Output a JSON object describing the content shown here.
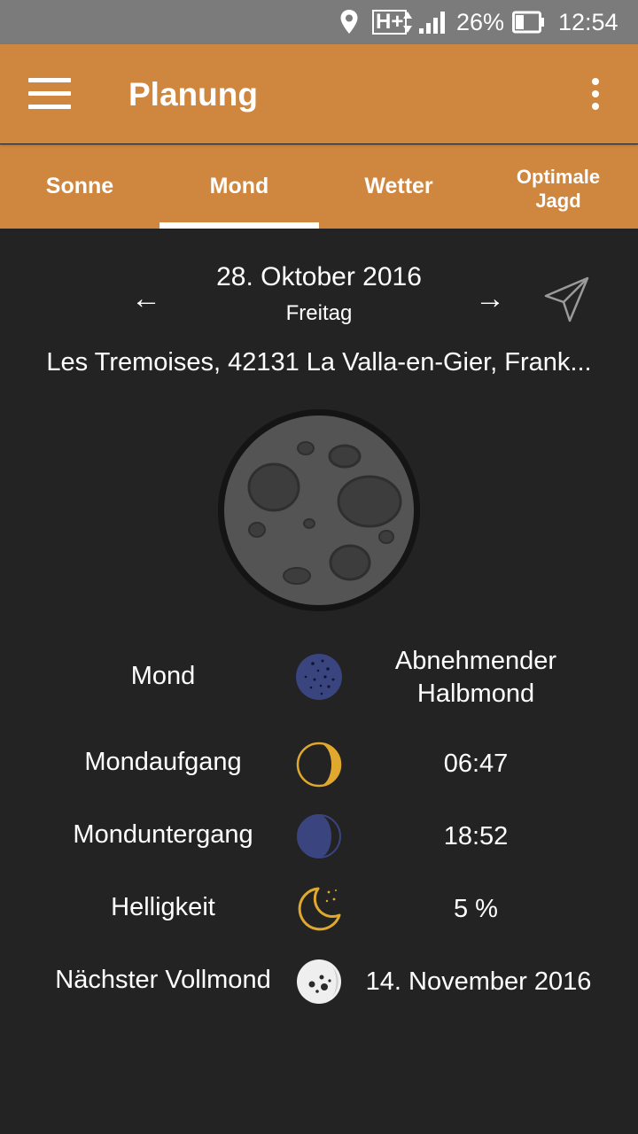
{
  "status_bar": {
    "network": "H+",
    "battery": "26%",
    "time": "12:54",
    "icons": [
      "location-pin-icon",
      "network-arrows-icon",
      "signal-icon",
      "battery-icon"
    ]
  },
  "app_bar": {
    "title": "Planung",
    "icons": [
      "menu-icon",
      "overflow-menu-icon"
    ]
  },
  "tabs": [
    {
      "label": "Sonne"
    },
    {
      "label": "Mond",
      "selected": true
    },
    {
      "label": "Wetter"
    },
    {
      "label": "Optimale\nJagd"
    }
  ],
  "date_nav": {
    "prev": "←",
    "next": "→",
    "date": "28. Oktober 2016",
    "weekday": "Freitag",
    "location_icon": "navigation-arrow-icon"
  },
  "location": "Les Tremoises, 42131 La Valla-en-Gier, Frank...",
  "moon_details": [
    {
      "label": "Mond",
      "value": "Abnehmender\nHalbmond",
      "icon": "moon-phase-icon"
    },
    {
      "label": "Mondaufgang",
      "value": "06:47",
      "icon": "moonrise-icon"
    },
    {
      "label": "Monduntergang",
      "value": "18:52",
      "icon": "moonset-icon"
    },
    {
      "label": "Helligkeit",
      "value": "5 %",
      "icon": "crescent-stars-icon"
    },
    {
      "label": "Nächster Vollmond",
      "value": "14. November 2016",
      "icon": "full-moon-icon"
    }
  ],
  "colors": {
    "accent": "#cf863f",
    "background": "#232323",
    "status_bar": "#7b7b7b",
    "moon_gold": "#e0a92e",
    "moon_blue": "#3a4580"
  }
}
